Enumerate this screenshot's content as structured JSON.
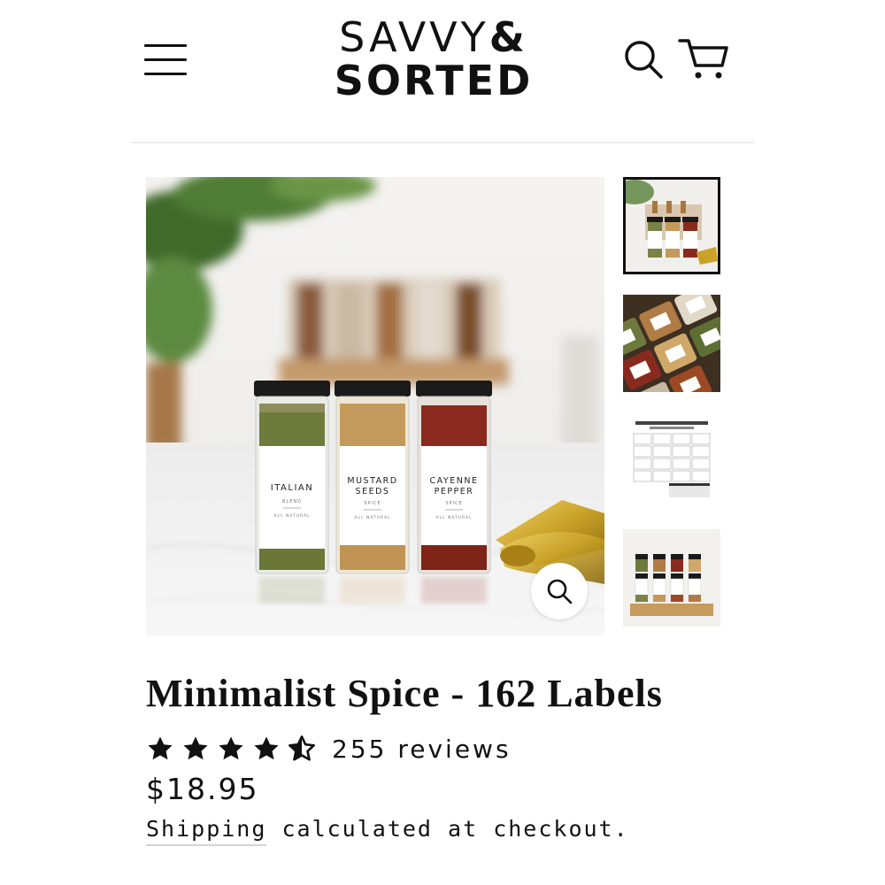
{
  "header": {
    "menu_icon": "hamburger-menu-icon",
    "logo_line1": "SAVVY",
    "logo_amp": "&",
    "logo_line2": "SORTED",
    "search_icon": "search-icon",
    "cart_icon": "cart-icon"
  },
  "gallery": {
    "zoom_icon": "zoom-icon",
    "main_labels": [
      {
        "name": "ITALIAN",
        "sub": "BLEND",
        "foot": "ALL NATURAL"
      },
      {
        "name1": "MUSTARD",
        "name2": "SEEDS",
        "sub": "SPICE",
        "foot": "ALL NATURAL"
      },
      {
        "name1": "CAYENNE",
        "name2": "PEPPER",
        "sub": "SPICE",
        "foot": "ALL NATURAL"
      }
    ],
    "thumbnails": [
      {
        "active": true
      },
      {
        "active": false
      },
      {
        "active": false
      },
      {
        "active": false
      }
    ]
  },
  "product": {
    "title": "Minimalist Spice - 162 Labels",
    "rating": 4.5,
    "reviews_text": "255 reviews",
    "price": "$18.95",
    "shipping_link": "Shipping",
    "shipping_rest": " calculated at checkout."
  },
  "colors": {
    "text": "#111111",
    "divider": "#ececec",
    "gold": "#c9a227"
  }
}
